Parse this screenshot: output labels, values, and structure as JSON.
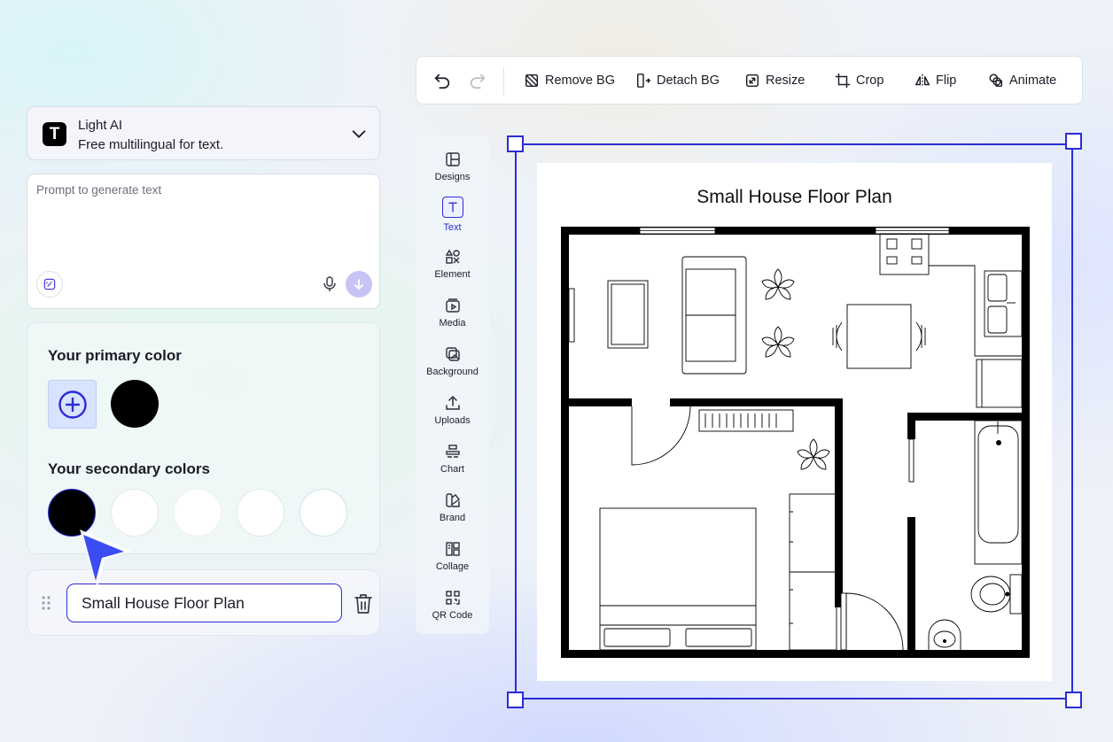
{
  "toolbar": {
    "undo": "undo-icon",
    "redo": "redo-icon",
    "buttons": [
      {
        "label": "Remove BG",
        "icon": "remove-bg-icon"
      },
      {
        "label": "Detach BG",
        "icon": "detach-bg-icon"
      },
      {
        "label": "Resize",
        "icon": "resize-icon"
      },
      {
        "label": "Crop",
        "icon": "crop-icon"
      },
      {
        "label": "Flip",
        "icon": "flip-icon"
      },
      {
        "label": "Animate",
        "icon": "animate-icon"
      }
    ]
  },
  "model": {
    "icon_letter": "T",
    "name": "Light AI",
    "description": "Free multilingual for text."
  },
  "prompt": {
    "placeholder": "Prompt to generate text"
  },
  "colors": {
    "primary_title": "Your primary color",
    "primary": "#000000",
    "secondary_title": "Your secondary colors",
    "secondary": [
      "#000000",
      "#ffffff",
      "#ffffff",
      "#ffffff",
      "#ffffff"
    ],
    "accent": "#2a2dd4"
  },
  "layer": {
    "text": "Small House Floor Plan"
  },
  "sidebar": {
    "items": [
      {
        "label": "Designs",
        "icon": "designs-icon"
      },
      {
        "label": "Text",
        "icon": "text-icon",
        "active": true
      },
      {
        "label": "Element",
        "icon": "element-icon"
      },
      {
        "label": "Media",
        "icon": "media-icon"
      },
      {
        "label": "Background",
        "icon": "background-icon"
      },
      {
        "label": "Uploads",
        "icon": "uploads-icon"
      },
      {
        "label": "Chart",
        "icon": "chart-icon"
      },
      {
        "label": "Brand",
        "icon": "brand-icon"
      },
      {
        "label": "Collage",
        "icon": "collage-icon"
      },
      {
        "label": "QR Code",
        "icon": "qr-code-icon"
      }
    ]
  },
  "canvas": {
    "title": "Small House Floor Plan"
  }
}
